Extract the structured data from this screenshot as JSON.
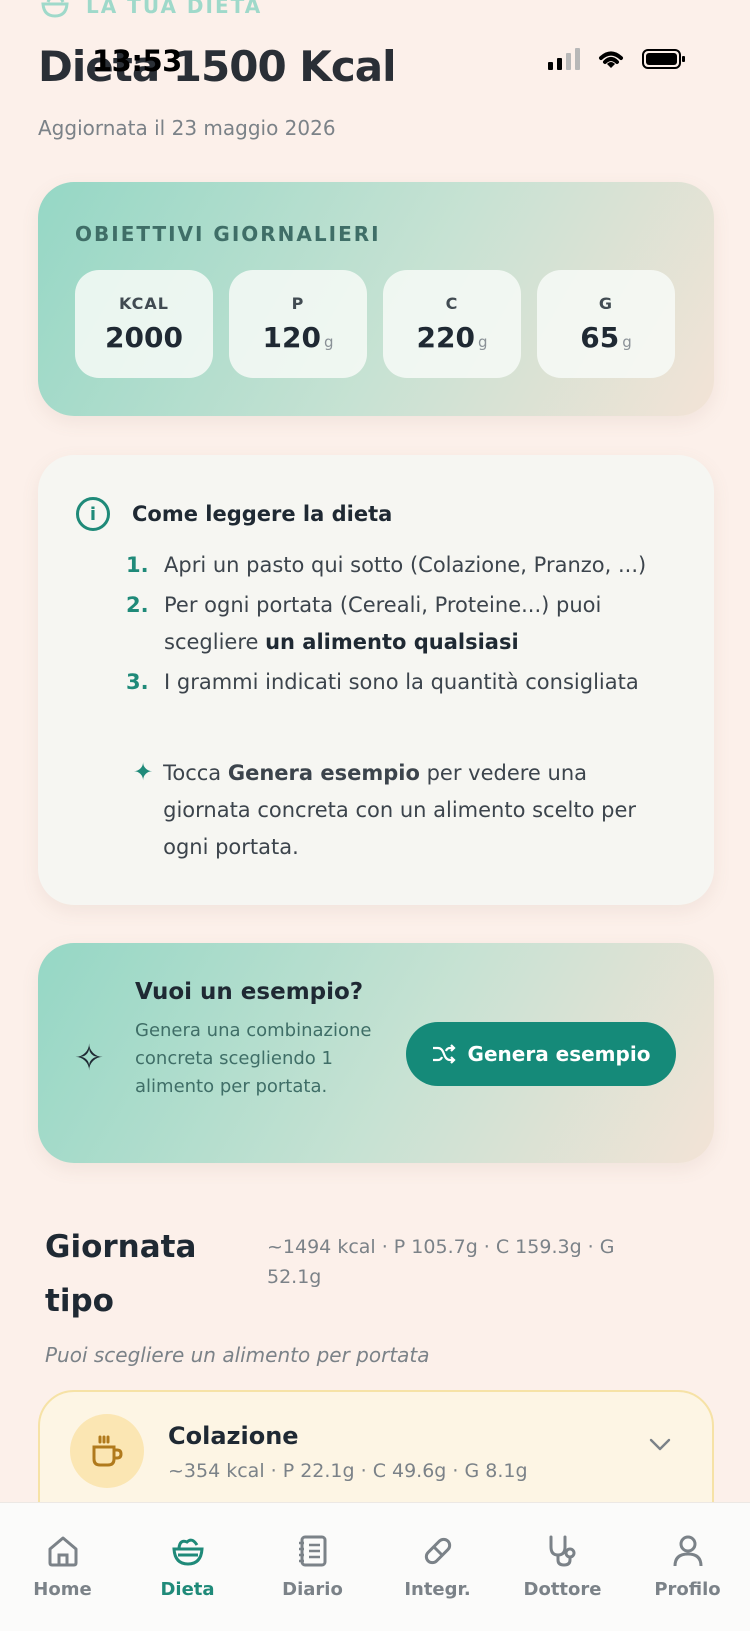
{
  "status": {
    "time": "13:53"
  },
  "header": {
    "eyebrow": "LA TUA DIETA",
    "title": "Dieta 1500 Kcal",
    "updated": "Aggiornata il 23 maggio 2026"
  },
  "goals": {
    "title": "OBIETTIVI GIORNALIERI",
    "items": [
      {
        "label": "KCAL",
        "value": "2000",
        "unit": ""
      },
      {
        "label": "P",
        "value": "120",
        "unit": "g"
      },
      {
        "label": "C",
        "value": "220",
        "unit": "g"
      },
      {
        "label": "G",
        "value": "65",
        "unit": "g"
      }
    ]
  },
  "info": {
    "title": "Come leggere la dieta",
    "steps": [
      {
        "num": "1.",
        "text": "Apri un pasto qui sotto (Colazione, Pranzo, ...)"
      },
      {
        "num": "2.",
        "text": "Per ogni portata (Cereali, Proteine...) puoi scegliere ",
        "bold": "un alimento qualsiasi"
      },
      {
        "num": "3.",
        "text": "I grammi indicati sono la quantità consigliata"
      }
    ],
    "tip_pre": "Tocca ",
    "tip_bold": "Genera esempio",
    "tip_post": " per vedere una giornata concreta con un alimento scelto per ogni portata."
  },
  "example": {
    "title": "Vuoi un esempio?",
    "description": "Genera una combinazione concreta scegliendo 1 alimento per portata.",
    "button_label": "Genera esempio"
  },
  "day": {
    "title": "Giornata tipo",
    "totals": "~1494 kcal · P 105.7g · C 159.3g · G 52.1g",
    "hint": "Puoi scegliere un alimento per portata"
  },
  "meals": [
    {
      "name": "Colazione",
      "macros": "~354 kcal · P 22.1g · C 49.6g · G 8.1g",
      "icon": "coffee-cup-icon"
    }
  ],
  "nav": {
    "items": [
      {
        "label": "Home",
        "icon": "home-icon"
      },
      {
        "label": "Dieta",
        "icon": "salad-bowl-icon",
        "active": true
      },
      {
        "label": "Diario",
        "icon": "notebook-icon"
      },
      {
        "label": "Integr.",
        "icon": "pill-icon"
      },
      {
        "label": "Dottore",
        "icon": "stethoscope-icon"
      },
      {
        "label": "Profilo",
        "icon": "user-icon"
      }
    ]
  },
  "colors": {
    "accent": "#1f8a79",
    "background": "#fcf0ea",
    "meal_card": "#fdf5e4"
  }
}
